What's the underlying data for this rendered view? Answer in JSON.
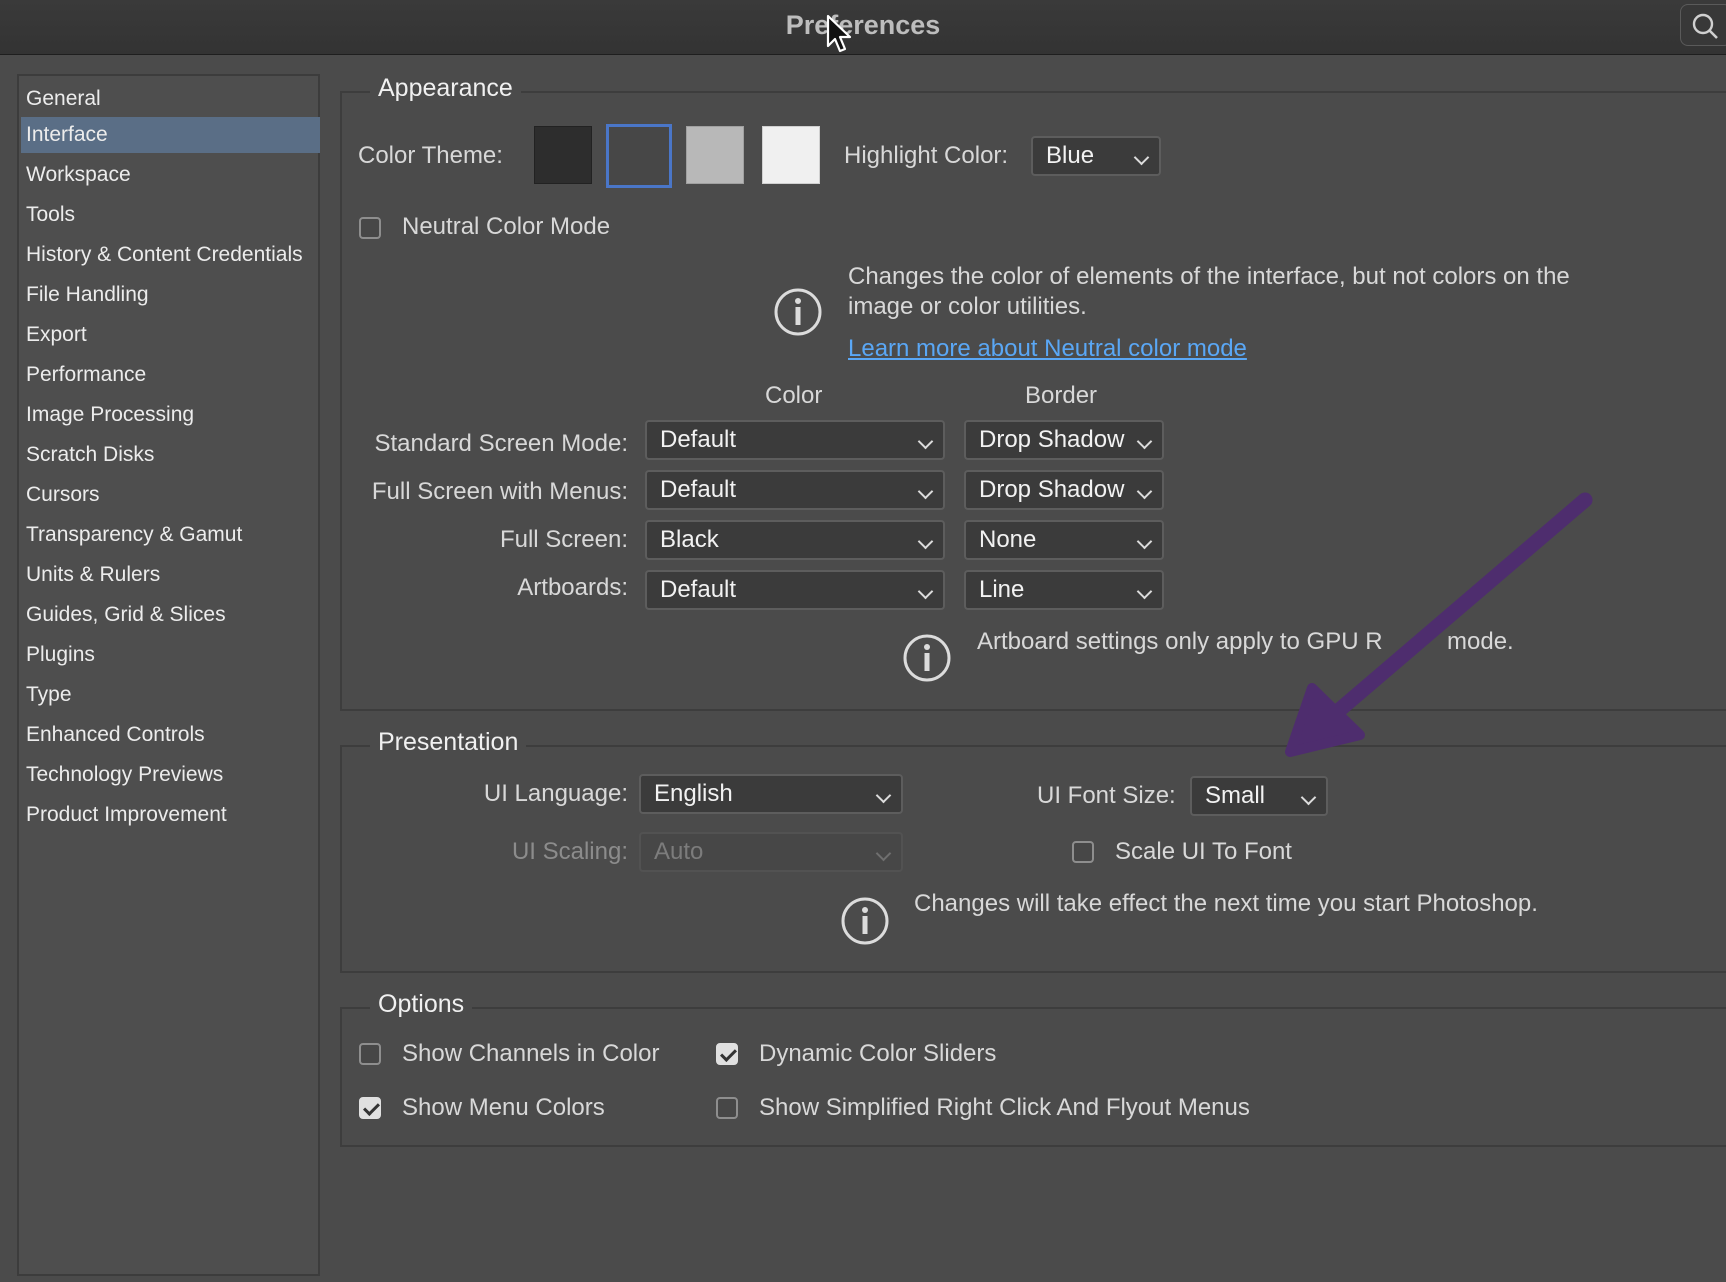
{
  "window": {
    "title": "Preferences"
  },
  "sidebar": {
    "items": [
      {
        "label": "General",
        "selected": false
      },
      {
        "label": "Interface",
        "selected": true
      },
      {
        "label": "Workspace",
        "selected": false
      },
      {
        "label": "Tools",
        "selected": false
      },
      {
        "label": "History & Content Credentials",
        "selected": false
      },
      {
        "label": "File Handling",
        "selected": false
      },
      {
        "label": "Export",
        "selected": false
      },
      {
        "label": "Performance",
        "selected": false
      },
      {
        "label": "Image Processing",
        "selected": false
      },
      {
        "label": "Scratch Disks",
        "selected": false
      },
      {
        "label": "Cursors",
        "selected": false
      },
      {
        "label": "Transparency & Gamut",
        "selected": false
      },
      {
        "label": "Units & Rulers",
        "selected": false
      },
      {
        "label": "Guides, Grid & Slices",
        "selected": false
      },
      {
        "label": "Plugins",
        "selected": false
      },
      {
        "label": "Type",
        "selected": false
      },
      {
        "label": "Enhanced Controls",
        "selected": false
      },
      {
        "label": "Technology Previews",
        "selected": false
      },
      {
        "label": "Product Improvement",
        "selected": false
      }
    ]
  },
  "appearance": {
    "section_label": "Appearance",
    "color_theme_label": "Color Theme:",
    "themes": [
      {
        "color": "#2d2d2d",
        "selected": false
      },
      {
        "color": "#474747",
        "selected": true
      },
      {
        "color": "#b8b8b8",
        "selected": false
      },
      {
        "color": "#f0f0f0",
        "selected": false
      }
    ],
    "highlight_color_label": "Highlight Color:",
    "highlight_color_value": "Blue",
    "neutral_mode_label": "Neutral Color Mode",
    "neutral_mode_checked": false,
    "neutral_info_line1": "Changes the color of elements of the interface, but not colors on the",
    "neutral_info_line2": "image or color utilities.",
    "neutral_link": "Learn more about Neutral color mode",
    "col_color": "Color",
    "col_border": "Border",
    "rows": [
      {
        "label": "Standard Screen Mode:",
        "color": "Default",
        "border": "Drop Shadow"
      },
      {
        "label": "Full Screen with Menus:",
        "color": "Default",
        "border": "Drop Shadow"
      },
      {
        "label": "Full Screen:",
        "color": "Black",
        "border": "None"
      },
      {
        "label": "Artboards:",
        "color": "Default",
        "border": "Line"
      }
    ],
    "artboard_info_a": "Artboard settings only apply to GPU R",
    "artboard_info_b": "mode."
  },
  "presentation": {
    "section_label": "Presentation",
    "ui_language_label": "UI Language:",
    "ui_language_value": "English",
    "ui_font_size_label": "UI Font Size:",
    "ui_font_size_value": "Small",
    "ui_scaling_label": "UI Scaling:",
    "ui_scaling_value": "Auto",
    "scale_ui_label": "Scale UI To Font",
    "scale_ui_checked": false,
    "info": "Changes will take effect the next time you start Photoshop."
  },
  "options": {
    "section_label": "Options",
    "show_channels_label": "Show Channels in Color",
    "show_channels_checked": false,
    "dynamic_sliders_label": "Dynamic Color Sliders",
    "dynamic_sliders_checked": true,
    "show_menu_colors_label": "Show Menu Colors",
    "show_menu_colors_checked": true,
    "simplified_menus_label": "Show Simplified Right Click And Flyout Menus",
    "simplified_menus_checked": false
  },
  "colors": {
    "selection": "#5a6e86",
    "link": "#5aa7f5",
    "annotation_arrow": "#4e2d6e"
  }
}
